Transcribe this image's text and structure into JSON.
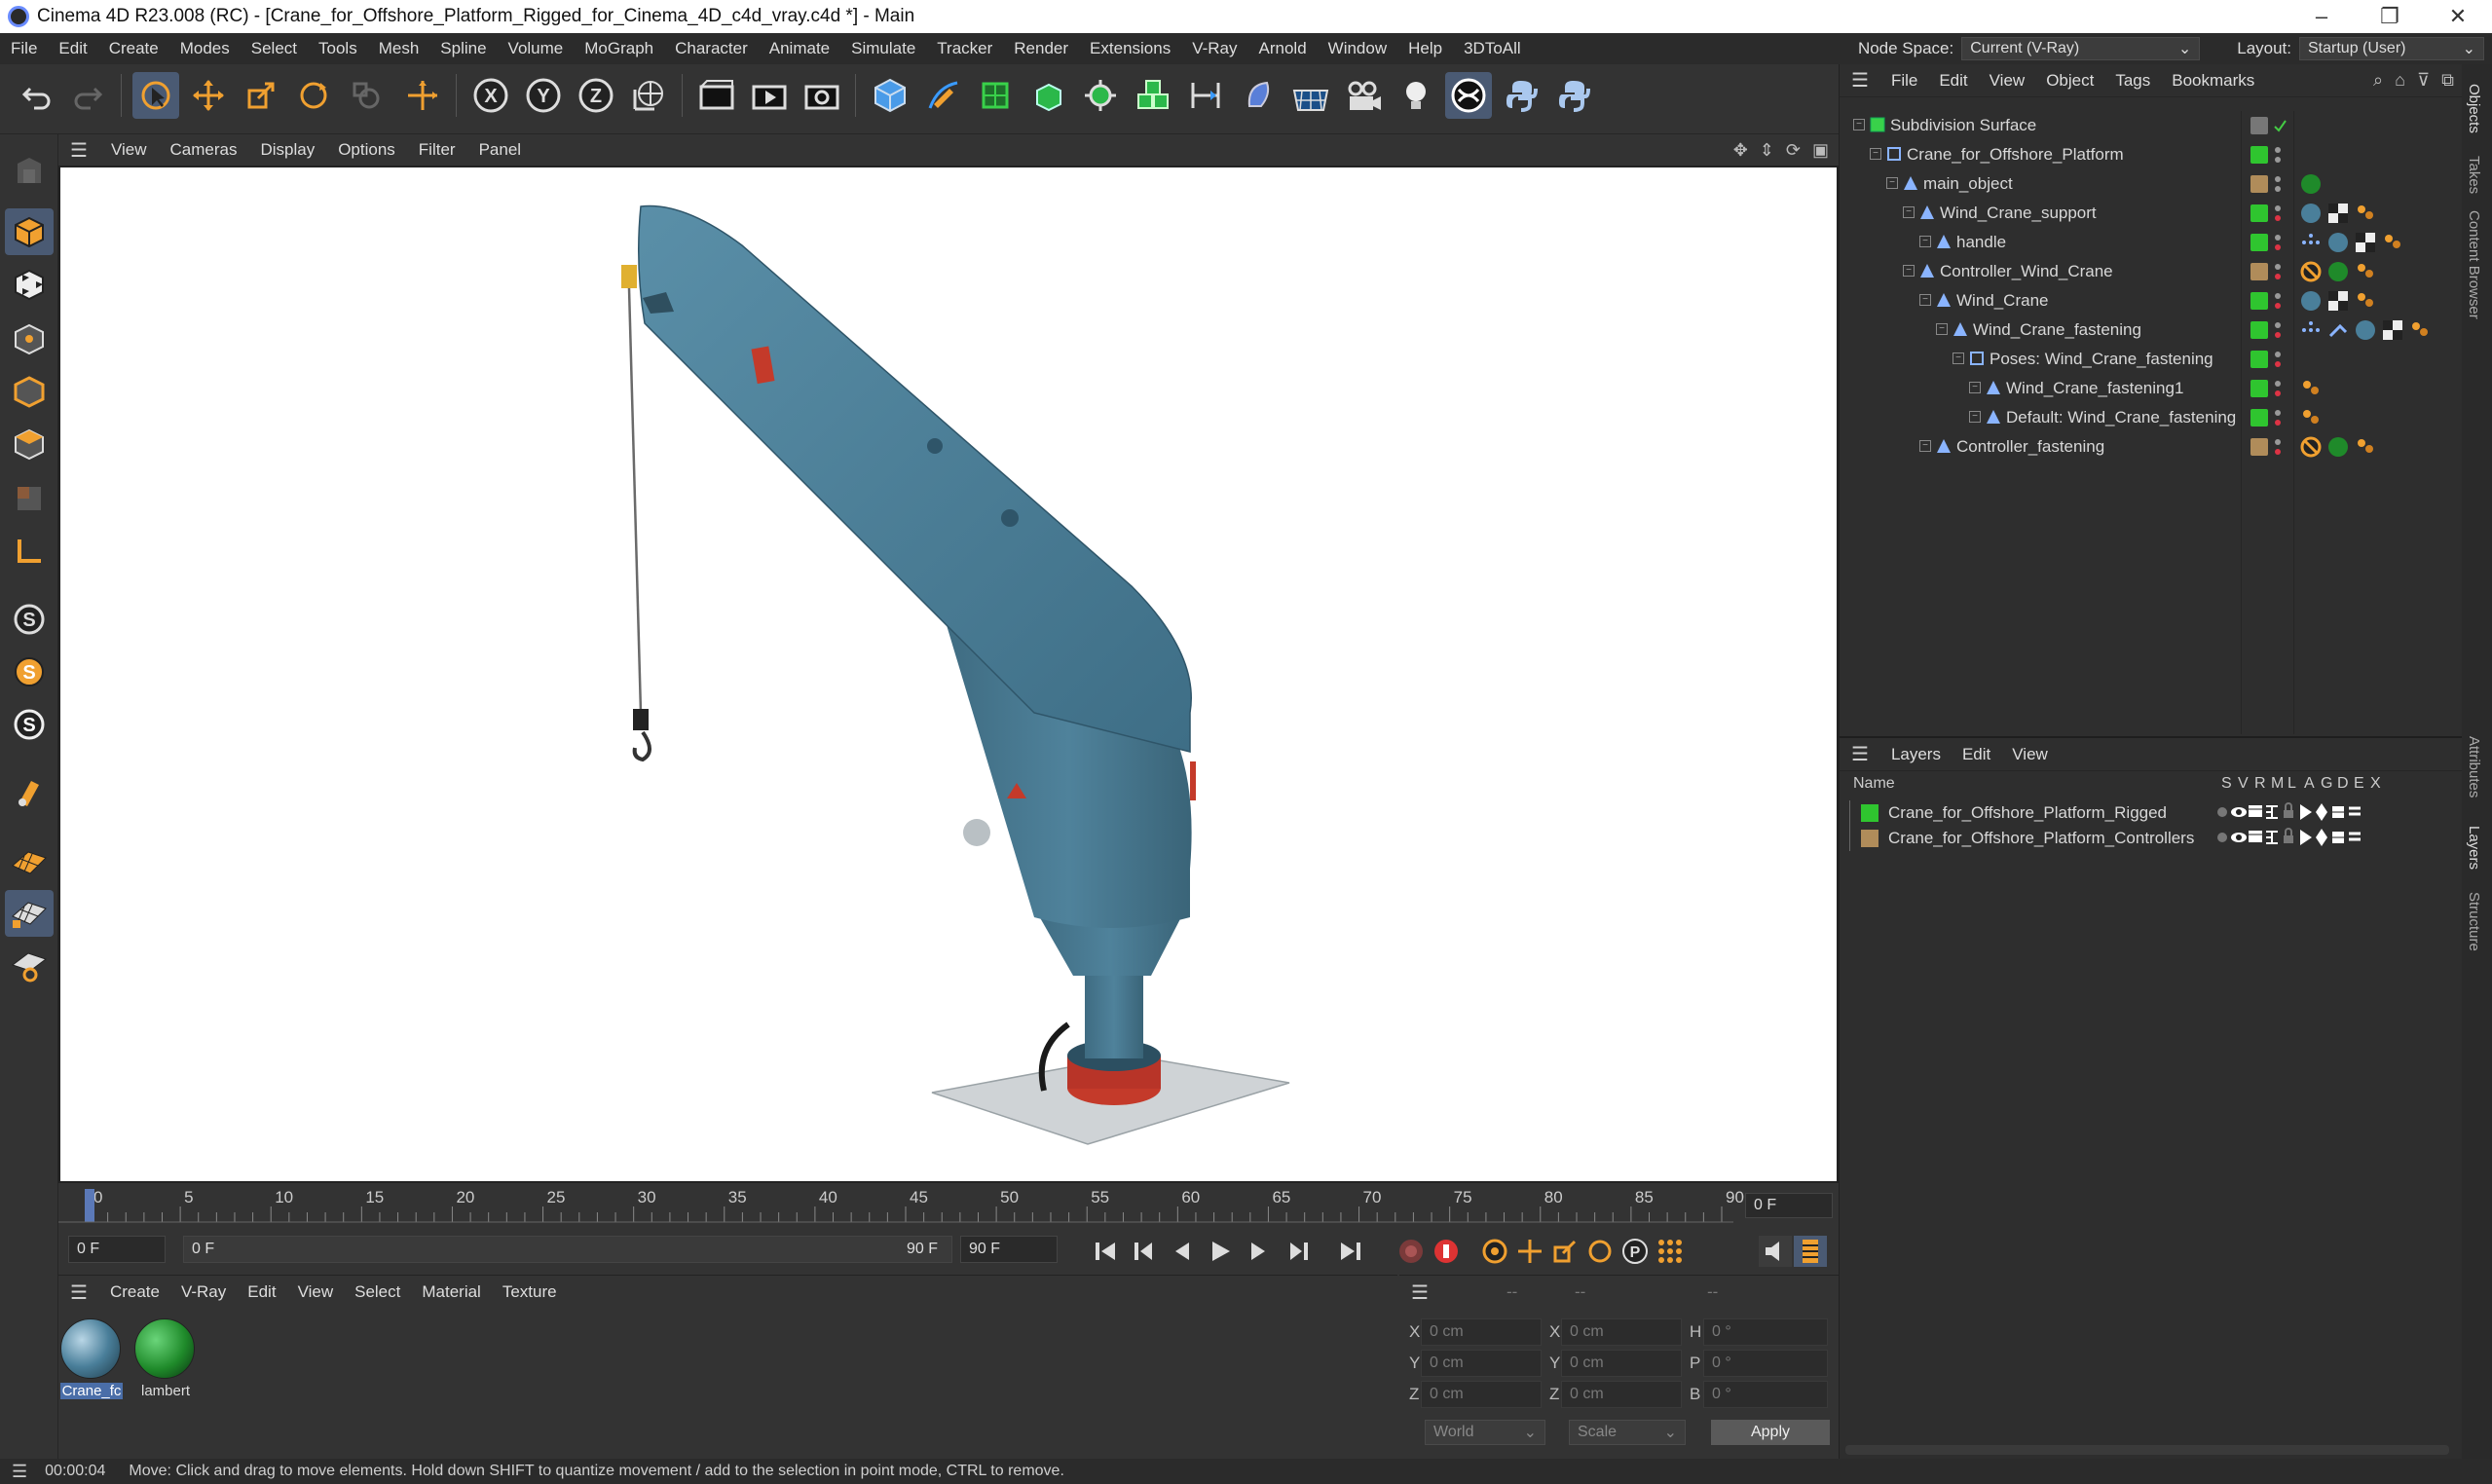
{
  "title_bar": {
    "title": "Cinema 4D R23.008 (RC) - [Crane_for_Offshore_Platform_Rigged_for_Cinema_4D_c4d_vray.c4d *] - Main",
    "minimize": "–",
    "maximize": "❐",
    "close": "✕"
  },
  "menu": {
    "items": [
      "File",
      "Edit",
      "Create",
      "Modes",
      "Select",
      "Tools",
      "Mesh",
      "Spline",
      "Volume",
      "MoGraph",
      "Character",
      "Animate",
      "Simulate",
      "Tracker",
      "Render",
      "Extensions",
      "V-Ray",
      "Arnold",
      "Window",
      "Help",
      "3DToAll"
    ],
    "node_space_label": "Node Space:",
    "node_space_value": "Current (V-Ray)",
    "layout_label": "Layout:",
    "layout_value": "Startup (User)"
  },
  "viewport_menu": {
    "items": [
      "View",
      "Cameras",
      "Display",
      "Options",
      "Filter",
      "Panel"
    ]
  },
  "object_manager": {
    "menu": [
      "File",
      "Edit",
      "View",
      "Object",
      "Tags",
      "Bookmarks"
    ],
    "objects": [
      {
        "name": "Subdivision Surface",
        "level": 0,
        "color": "#777777"
      },
      {
        "name": "Crane_for_Offshore_Platform",
        "level": 1,
        "color": "#2fc52f"
      },
      {
        "name": "main_object",
        "level": 2,
        "color": "#b08c5a"
      },
      {
        "name": "Wind_Crane_support",
        "level": 3,
        "color": "#2fc52f"
      },
      {
        "name": "handle",
        "level": 4,
        "color": "#2fc52f"
      },
      {
        "name": "Controller_Wind_Crane",
        "level": 3,
        "color": "#b08c5a"
      },
      {
        "name": "Wind_Crane",
        "level": 4,
        "color": "#2fc52f"
      },
      {
        "name": "Wind_Crane_fastening",
        "level": 5,
        "color": "#2fc52f"
      },
      {
        "name": "Poses: Wind_Crane_fastening",
        "level": 6,
        "color": "#2fc52f"
      },
      {
        "name": "Wind_Crane_fastening1",
        "level": 7,
        "color": "#2fc52f"
      },
      {
        "name": "Default: Wind_Crane_fastening",
        "level": 7,
        "color": "#2fc52f"
      },
      {
        "name": "Controller_fastening",
        "level": 4,
        "color": "#b08c5a"
      }
    ]
  },
  "layer_manager": {
    "menu": [
      "Layers",
      "Edit",
      "View"
    ],
    "header": {
      "name": "Name",
      "cols": [
        "S",
        "V",
        "R",
        "M",
        "L",
        "A",
        "G",
        "D",
        "E",
        "X"
      ]
    },
    "layers": [
      {
        "name": "Crane_for_Offshore_Platform_Rigged",
        "color": "#2fc52f"
      },
      {
        "name": "Crane_for_Offshore_Platform_Controllers",
        "color": "#b08c5a"
      }
    ]
  },
  "side_tabs": [
    "Objects",
    "Takes",
    "Content Browser",
    "Attributes",
    "Layers",
    "Structure"
  ],
  "timeline": {
    "ticks": [
      "0",
      "5",
      "10",
      "15",
      "20",
      "25",
      "30",
      "35",
      "40",
      "45",
      "50",
      "55",
      "60",
      "65",
      "70",
      "75",
      "80",
      "85",
      "90"
    ],
    "current_frame": "0 F",
    "playhead_frame": 0
  },
  "playback": {
    "start": "0 F",
    "range_start": "0 F",
    "range_end": "90 F",
    "end": "90 F"
  },
  "material_manager": {
    "menu": [
      "Create",
      "V-Ray",
      "Edit",
      "View",
      "Select",
      "Material",
      "Texture"
    ],
    "materials": [
      {
        "label": "Crane_fc",
        "color": "#4a7f9a"
      },
      {
        "label": "lambert",
        "color": "#1f8a2a"
      }
    ]
  },
  "coordinates": {
    "headers": [
      "--",
      "--",
      "--"
    ],
    "rows": [
      {
        "a": "X",
        "av": "0 cm",
        "b": "X",
        "bv": "0 cm",
        "c": "H",
        "cv": "0 °"
      },
      {
        "a": "Y",
        "av": "0 cm",
        "b": "Y",
        "bv": "0 cm",
        "c": "P",
        "cv": "0 °"
      },
      {
        "a": "Z",
        "av": "0 cm",
        "b": "Z",
        "bv": "0 cm",
        "c": "B",
        "cv": "0 °"
      }
    ],
    "mode": "World",
    "size": "Scale",
    "apply": "Apply"
  },
  "status": {
    "time": "00:00:04",
    "message": "Move: Click and drag to move elements. Hold down SHIFT to quantize movement / add to the selection in point mode, CTRL to remove."
  },
  "colors": {
    "accent": "#4a5a73",
    "crane": "#4b7c92",
    "ui_bg": "#333333"
  }
}
